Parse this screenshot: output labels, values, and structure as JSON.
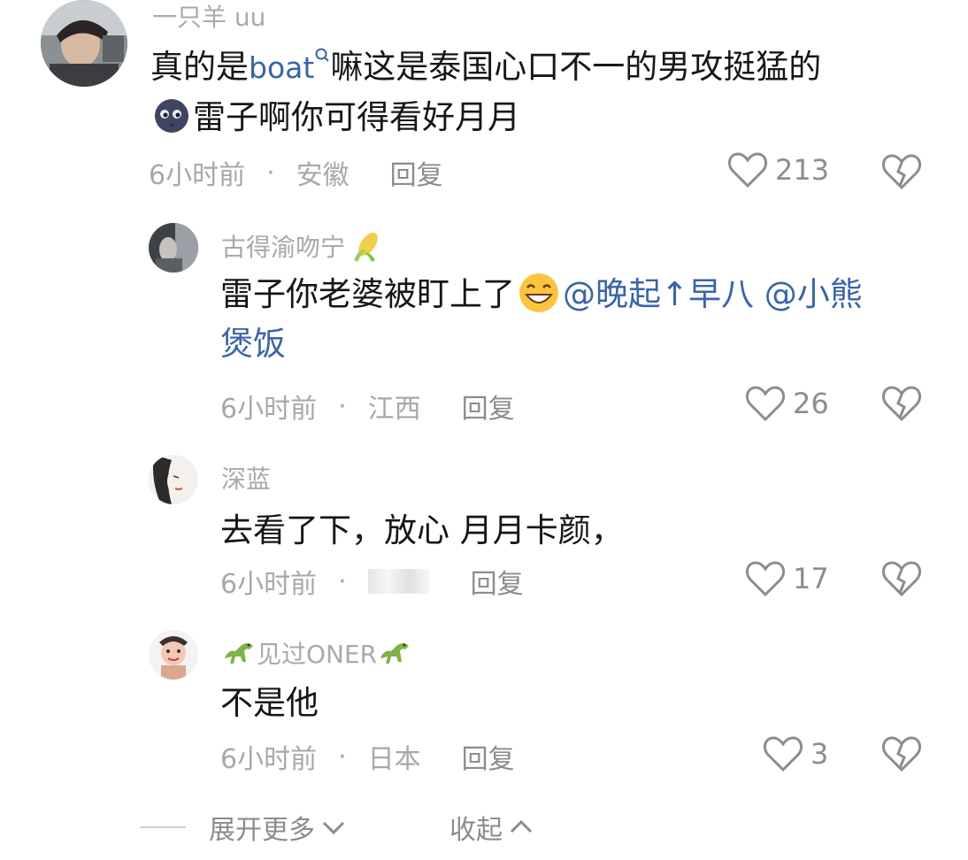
{
  "comments": [
    {
      "username": "一只羊 uu",
      "text_prefix": "真的是",
      "link_text": "boat",
      "text_mid": "嘛这是泰国心口不一的男攻挺猛的",
      "text_suffix": "雷子啊你可得看好月月",
      "time": "6小时前",
      "dot": "·",
      "location": "安徽",
      "reply_label": "回复",
      "likes": "213"
    },
    {
      "username": "古得渝吻宁",
      "text_prefix": "雷子你老婆被盯上了",
      "mention1": "@晚起↑早八",
      "mention2": "@小熊",
      "mention2_cont": "煲饭",
      "time": "6小时前",
      "dot": "·",
      "location": "江西",
      "reply_label": "回复",
      "likes": "26"
    },
    {
      "username": "深蓝",
      "text": "去看了下，放心 月月卡颜，",
      "time": "6小时前",
      "dot": "·",
      "location": "",
      "reply_label": "回复",
      "likes": "17"
    },
    {
      "username": "见过ONER",
      "text": "不是他",
      "time": "6小时前",
      "dot": "·",
      "location": "日本",
      "reply_label": "回复",
      "likes": "3"
    }
  ],
  "footer": {
    "expand_label": "展开更多",
    "collapse_label": "收起"
  },
  "colors": {
    "link": "#3a64a8",
    "meta": "#a8a8a8"
  },
  "icons": [
    "heart-outline-icon",
    "broken-heart-icon",
    "search-icon",
    "moon-emoji-icon",
    "grin-emoji-icon",
    "corn-icon",
    "dinosaur-icon",
    "chevron-down-icon",
    "chevron-up-icon"
  ]
}
